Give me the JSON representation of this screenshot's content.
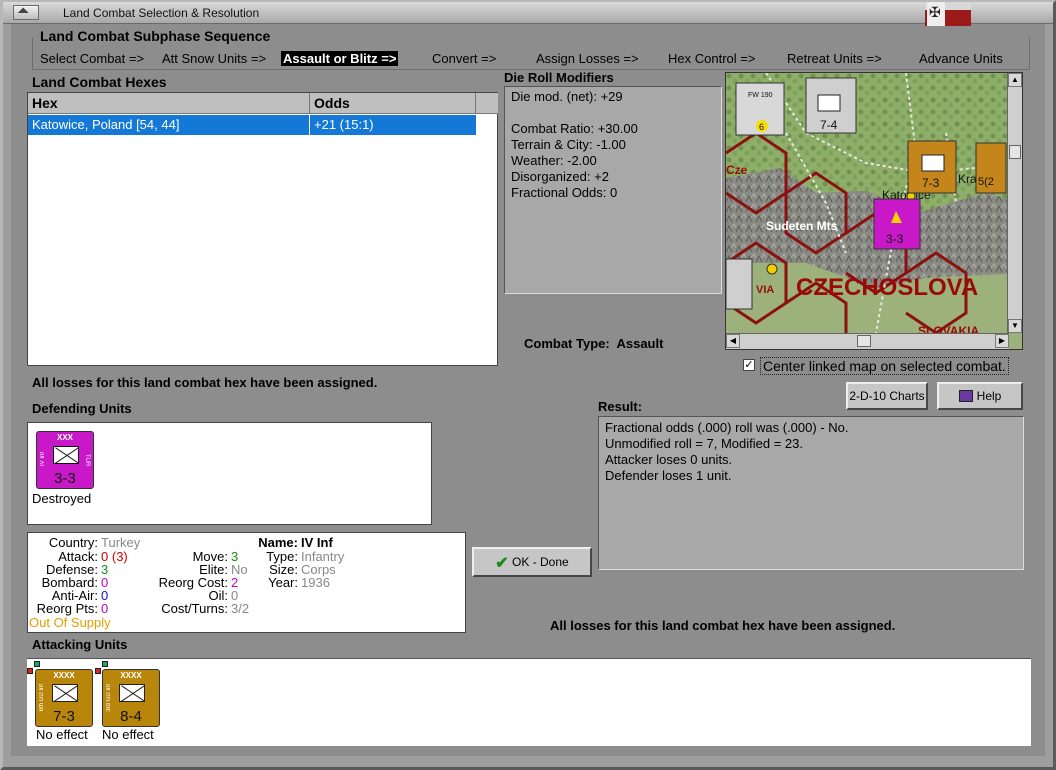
{
  "window": {
    "title": "Land Combat Selection & Resolution"
  },
  "subphase": {
    "title": "Land Combat Subphase Sequence",
    "phases": [
      "Select Combat =>",
      "Att Snow Units =>",
      "Assault or Blitz =>",
      "Convert =>",
      "Assign Losses =>",
      "Hex Control =>",
      "Retreat Units =>",
      "Advance Units"
    ],
    "active_index": 2
  },
  "hexes": {
    "title": "Land Combat Hexes",
    "columns": [
      "Hex",
      "Odds"
    ],
    "rows": [
      {
        "hex": "Katowice, Poland [54, 44]",
        "odds": "+21 (15:1)"
      }
    ]
  },
  "die_roll": {
    "title": "Die Roll Modifiers",
    "lines": [
      "Die mod. (net): +29",
      "",
      "Combat Ratio: +30.00",
      "Terrain & City: -1.00",
      "Weather: -2.00",
      "Disorganized: +2",
      "Fractional Odds: 0"
    ]
  },
  "combat_type": {
    "label": "Combat Type:",
    "value": "Assault"
  },
  "map": {
    "labels": [
      "Sudeten Mts",
      "CZECHOSLOVA",
      "SLOVAKIA",
      "Katowice",
      "Cze",
      "Kra",
      "VIA"
    ],
    "units": [
      {
        "text": "FW 190",
        "strength": "6"
      },
      {
        "text": "7-4"
      },
      {
        "text": "7-3"
      },
      {
        "text": "3-3"
      },
      {
        "text": "5(2"
      }
    ]
  },
  "center_map": {
    "label": "Center linked map on selected combat.",
    "checked": true
  },
  "buttons": {
    "charts": "2-D-10 Charts",
    "help": "Help",
    "ok": "OK - Done"
  },
  "assigned_message": "All losses for this land combat hex have been assigned.",
  "result": {
    "title": "Result:",
    "lines": [
      "Fractional odds (.000) roll was (.000)  - No.",
      "Unmodified roll = 7, Modified = 23.",
      "Attacker loses 0 units.",
      "Defender loses 1 unit."
    ]
  },
  "defending": {
    "title": "Defending Units",
    "units": [
      {
        "echelon": "XXX",
        "name": "IV Inf",
        "country": "TUR",
        "strength": "3-3",
        "status": "Destroyed",
        "color": "#c818c8"
      }
    ]
  },
  "unit_info": {
    "country": "Turkey",
    "attack": "0",
    "attack_paren": "(3)",
    "defense": "3",
    "bombard": "0",
    "anti_air": "0",
    "reorg_pts": "0",
    "supply": "Out Of Supply",
    "move": "3",
    "elite": "No",
    "reorg_cost": "2",
    "oil": "0",
    "cost_turns": "3/2",
    "name": "IV Inf",
    "type": "Infantry",
    "size": "Corps",
    "year": "1936",
    "labels": {
      "country": "Country:",
      "attack": "Attack:",
      "defense": "Defense:",
      "bombard": "Bombard:",
      "anti_air": "Anti-Air:",
      "reorg_pts": "Reorg Pts:",
      "move": "Move:",
      "elite": "Elite:",
      "reorg_cost": "Reorg Cost:",
      "oil": "Oil:",
      "cost_turns": "Cost/Turns:",
      "name": "Name:",
      "type": "Type:",
      "size": "Size:",
      "year": "Year:"
    }
  },
  "attacking": {
    "title": "Attacking Units",
    "units": [
      {
        "echelon": "XXXX",
        "name": "6th GD Inf",
        "strength": "7-3",
        "status": "No effect",
        "color": "#b8860b"
      },
      {
        "echelon": "XXXX",
        "name": "3rd GD Inf",
        "strength": "8-4",
        "status": "No effect",
        "color": "#b8860b"
      }
    ]
  },
  "colors": {
    "selection": "#1479d6",
    "counter_german": "#b8860b",
    "counter_turk": "#c818c8",
    "red_text": "#d00000",
    "green_text": "#109010",
    "blue_text": "#1010d0",
    "purple_text": "#c000c0",
    "supply_text": "#e0a000"
  }
}
